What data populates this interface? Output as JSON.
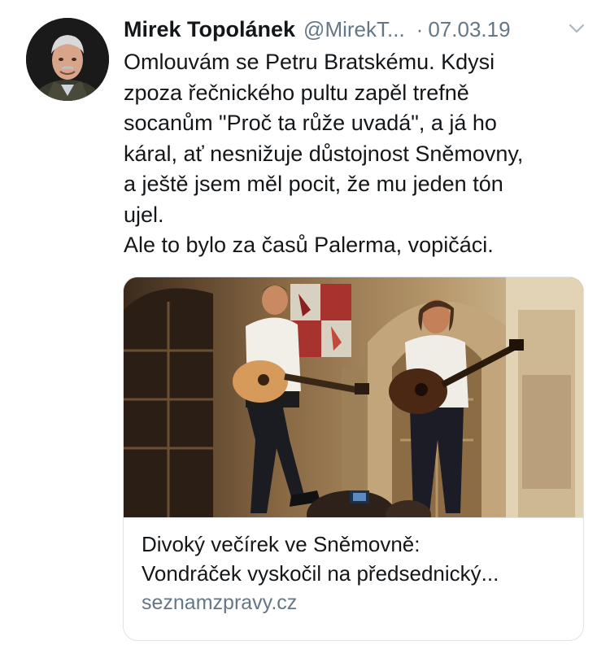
{
  "author": {
    "display_name": "Mirek Topolánek",
    "handle": "@MirekT...",
    "separator": "·",
    "date": "07.03.19",
    "avatar_icon": "avatar-portrait"
  },
  "tweet": {
    "lines": [
      "Omlouvám se Petru Bratskému. Kdysi",
      "zpoza řečnického pultu zapěl trefně",
      "socanům \"Proč ta růže uvadá\", a já ho",
      "káral, ať nesnižuje důstojnost Sněmovny,",
      "a ještě jsem měl pocit, že mu jeden tón",
      "ujel.",
      "Ale to bylo za časů Palerma, vopičáci."
    ]
  },
  "card": {
    "title_lines": [
      "Divoký večírek ve Sněmovně:",
      "Vondráček vyskočil na předsednický..."
    ],
    "domain": "seznamzpravy.cz"
  },
  "colors": {
    "text": "#14171a",
    "secondary": "#657786",
    "border": "#dde3e8"
  },
  "icons": {
    "more": "chevron-down-icon"
  }
}
